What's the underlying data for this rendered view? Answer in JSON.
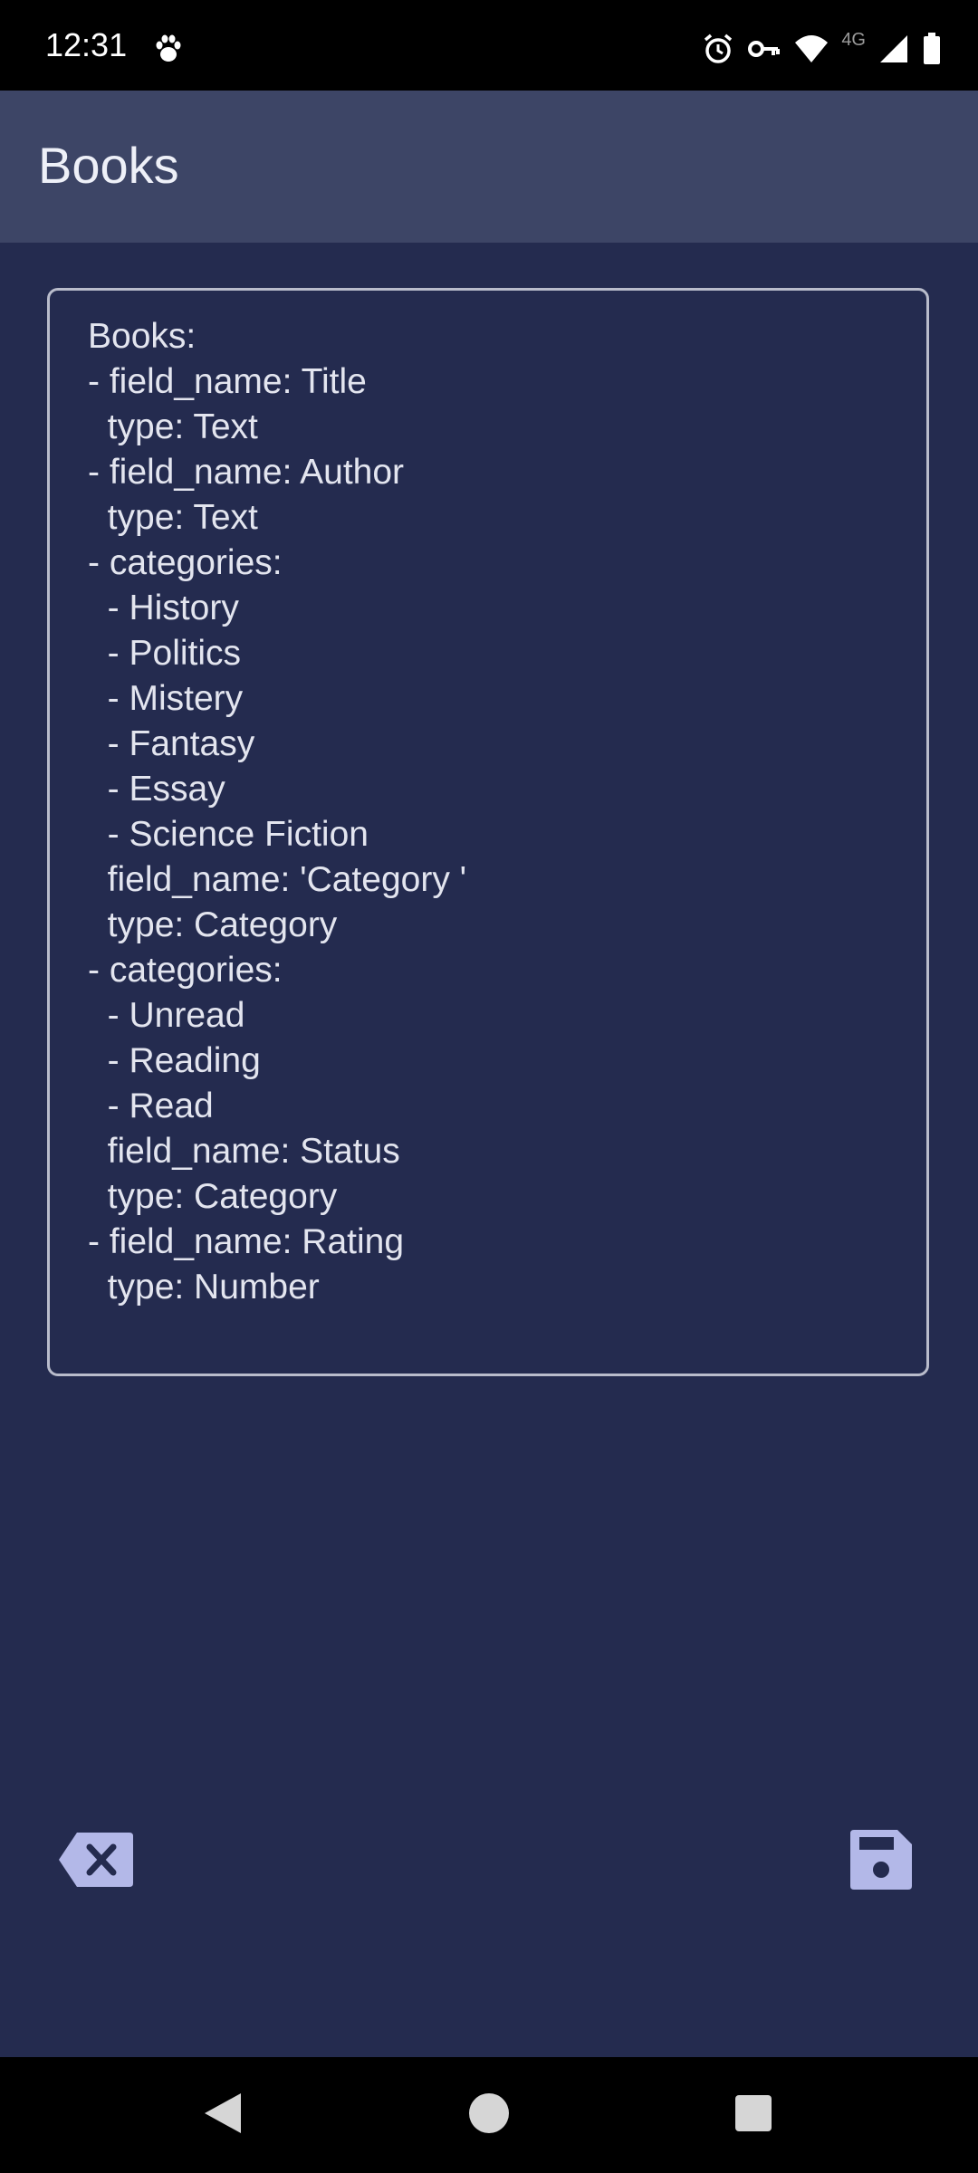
{
  "status_bar": {
    "time": "12:31",
    "network_label": "4G",
    "icons": [
      "paw-icon",
      "alarm-icon",
      "vpn-key-icon",
      "wifi-icon",
      "cell-signal-icon",
      "battery-icon"
    ]
  },
  "app_bar": {
    "title": "Books"
  },
  "editor": {
    "content": "Books:\n- field_name: Title\n  type: Text\n- field_name: Author\n  type: Text\n- categories:\n  - History\n  - Politics\n  - Mistery\n  - Fantasy\n  - Essay\n  - Science Fiction\n  field_name: 'Category '\n  type: Category\n- categories:\n  - Unread\n  - Reading\n  - Read\n  field_name: Status\n  type: Category\n- field_name: Rating\n  type: Number"
  },
  "actions": {
    "clear_icon": "backspace-clear-icon",
    "save_icon": "save-icon"
  },
  "colors": {
    "background": "#242b4f",
    "app_bar": "#3d4566",
    "icon_accent": "#b3b8e8",
    "text": "#e3e5ef"
  }
}
